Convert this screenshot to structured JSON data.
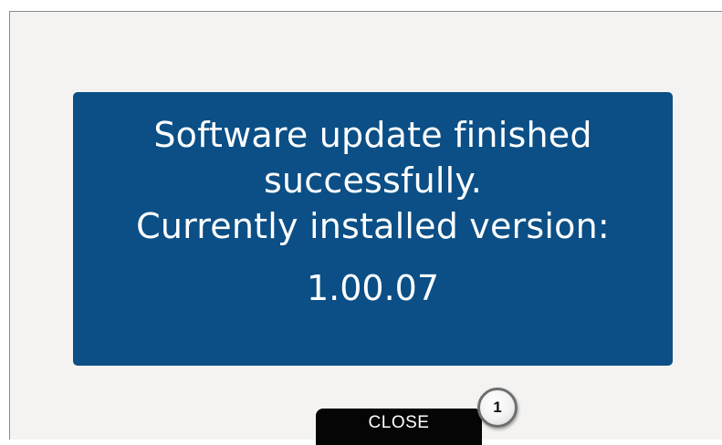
{
  "dialog": {
    "message_lines": [
      "Software update finished",
      "successfully.",
      "Currently installed version:"
    ],
    "version": "1.00.07"
  },
  "buttons": {
    "close_label": "CLOSE"
  },
  "callout": {
    "number": "1"
  },
  "colors": {
    "screen_background": "#f4f3f1",
    "panel_background": "#0b4f86",
    "panel_text": "#ffffff",
    "button_background": "#050505"
  }
}
